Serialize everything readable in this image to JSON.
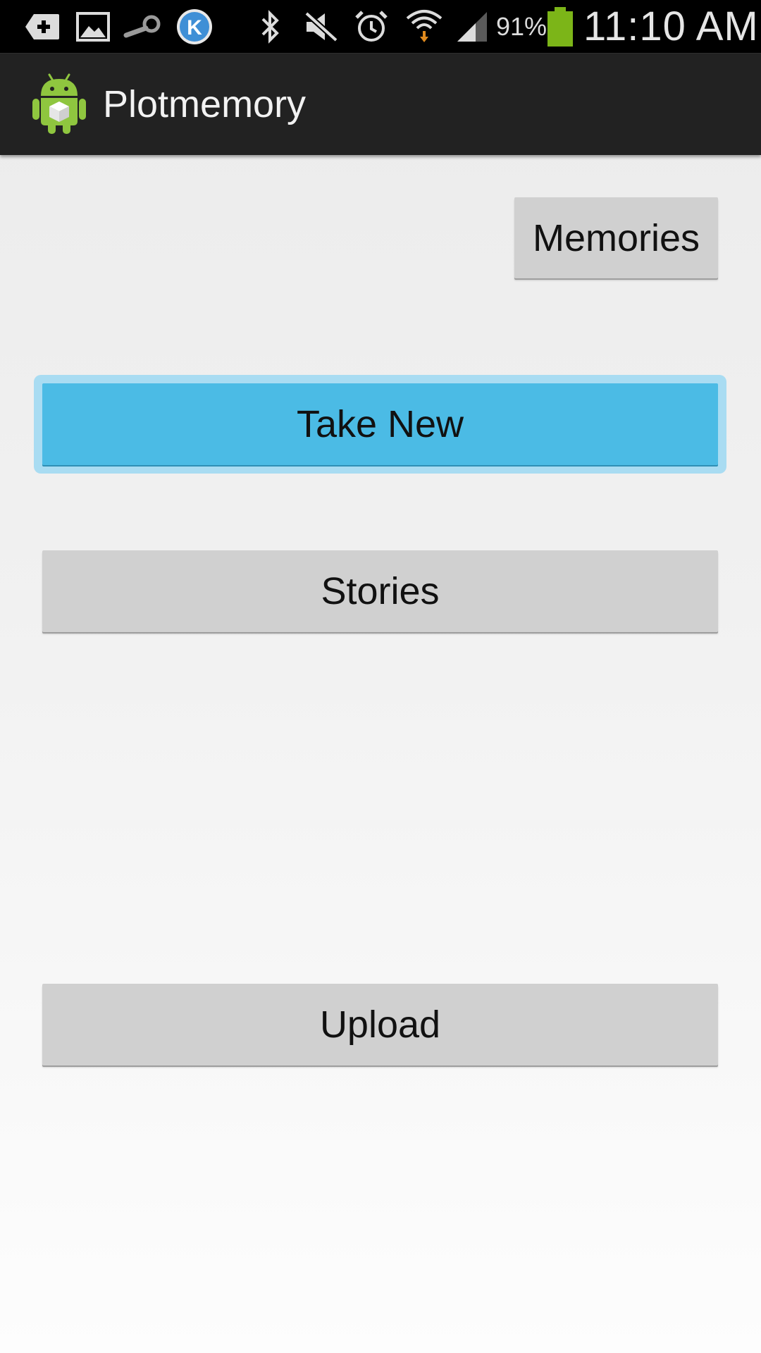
{
  "status_bar": {
    "battery_percent": "91%",
    "time": "11:10 AM",
    "icons": [
      "add-notification-icon",
      "image-icon",
      "steam-icon",
      "k-app-icon",
      "bluetooth-icon",
      "mute-icon",
      "alarm-icon",
      "wifi-icon",
      "signal-icon",
      "battery-icon"
    ]
  },
  "action_bar": {
    "title": "Plotmemory",
    "icon": "android-app-icon"
  },
  "buttons": {
    "memories": "Memories",
    "take_new": "Take New",
    "stories": "Stories",
    "upload": "Upload"
  },
  "colors": {
    "accent": "#4bbbe5",
    "focus_ring": "#a9dcf2",
    "button": "#d0d0d0",
    "action_bar": "#222222",
    "battery": "#7cb518"
  }
}
